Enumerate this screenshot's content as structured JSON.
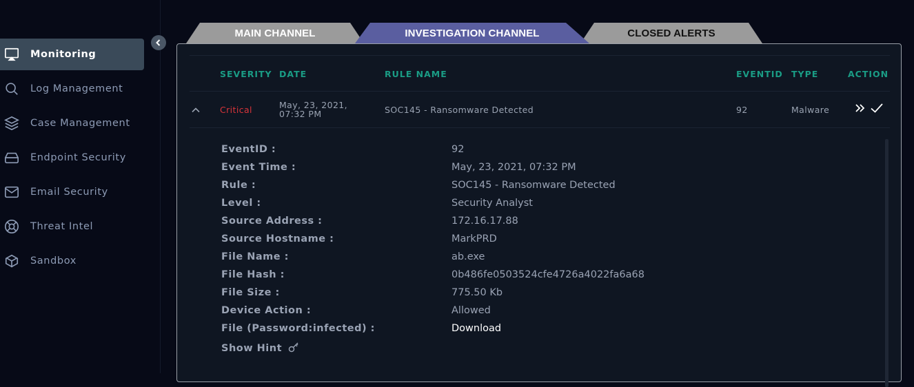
{
  "sidebar": {
    "items": [
      {
        "label": "Monitoring",
        "icon": "monitor-icon",
        "active": true
      },
      {
        "label": "Log Management",
        "icon": "search-icon"
      },
      {
        "label": "Case Management",
        "icon": "layers-icon"
      },
      {
        "label": "Endpoint Security",
        "icon": "hard-drive-icon"
      },
      {
        "label": "Email Security",
        "icon": "mail-icon"
      },
      {
        "label": "Threat Intel",
        "icon": "lifebuoy-icon"
      },
      {
        "label": "Sandbox",
        "icon": "box-icon"
      }
    ]
  },
  "tabs": [
    {
      "label": "MAIN CHANNEL"
    },
    {
      "label": "INVESTIGATION CHANNEL",
      "active": true
    },
    {
      "label": "CLOSED ALERTS"
    }
  ],
  "table": {
    "headers": {
      "severity": "SEVERITY",
      "date": "DATE",
      "rule_name": "RULE NAME",
      "eventid": "EVENTID",
      "type": "TYPE",
      "action": "ACTION"
    },
    "row": {
      "severity": "Critical",
      "date": "May, 23, 2021, 07:32 PM",
      "rule_name": "SOC145 - Ransomware Detected",
      "eventid": "92",
      "type": "Malware"
    }
  },
  "details": {
    "labels": {
      "eventid": "EventID :",
      "event_time": "Event Time :",
      "rule": "Rule :",
      "level": "Level :",
      "source_address": "Source Address :",
      "source_hostname": "Source Hostname :",
      "file_name": "File Name :",
      "file_hash": "File Hash :",
      "file_size": "File Size :",
      "device_action": "Device Action :",
      "file_password": "File (Password:infected) :",
      "show_hint": "Show Hint"
    },
    "values": {
      "eventid": "92",
      "event_time": "May, 23, 2021, 07:32 PM",
      "rule": "SOC145 - Ransomware Detected",
      "level": "Security Analyst",
      "source_address": "172.16.17.88",
      "source_hostname": "MarkPRD",
      "file_name": "ab.exe",
      "file_hash": "0b486fe0503524cfe4726a4022fa6a68",
      "file_size": "775.50 Kb",
      "device_action": "Allowed",
      "file_password": "Download"
    }
  },
  "colors": {
    "background": "#070a17",
    "panel": "#0f1622",
    "accent_teal": "#1a9c85",
    "critical": "#d9343a",
    "active_tab": "#5a5ea0",
    "inactive_tab": "#9b9b9b"
  }
}
